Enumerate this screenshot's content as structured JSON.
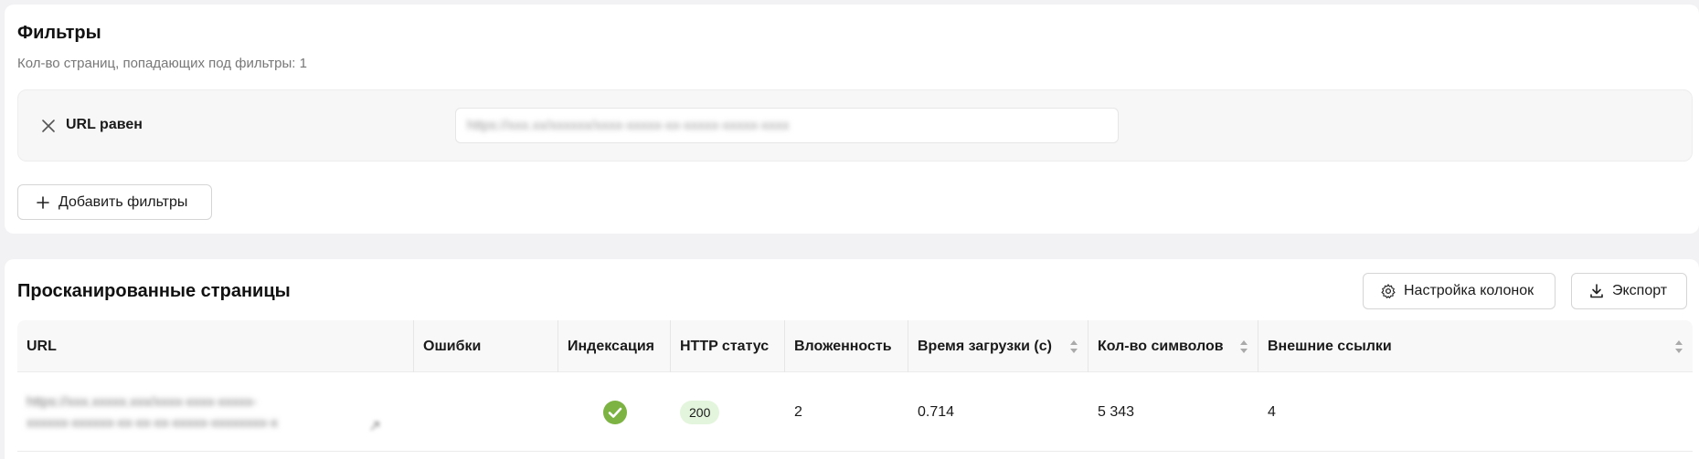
{
  "filters": {
    "title": "Фильтры",
    "count_text": "Кол-во страниц, попадающих под фильтры: 1",
    "condition": {
      "label": "URL равен",
      "value_blurred": "https://xxx.xx/xxxxxx/xxxx-xxxxx-xx-xxxxx-xxxxx-xxxx"
    },
    "add_button": "Добавить фильтры"
  },
  "pages": {
    "title": "Просканированные страницы",
    "columns_button": "Настройка колонок",
    "export_button": "Экспорт",
    "columns": [
      {
        "label": "URL",
        "sortable": false
      },
      {
        "label": "Ошибки",
        "sortable": false
      },
      {
        "label": "Индексация",
        "sortable": false
      },
      {
        "label": "HTTP статус",
        "sortable": false
      },
      {
        "label": "Вложенность",
        "sortable": false
      },
      {
        "label": "Время загрузки (с)",
        "sortable": true
      },
      {
        "label": "Кол-во символов",
        "sortable": true
      },
      {
        "label": "Внешние ссылки",
        "sortable": true
      }
    ],
    "rows": [
      {
        "url_line1": "https://xxx.xxxxx.xxx/xxxx-xxxx-xxxxx-",
        "url_line2": "xxxxxx-xxxxxx-xx-xx-xx-xxxxx-xxxxxxxx-x",
        "errors": "",
        "indexed": true,
        "http_status": "200",
        "depth": "2",
        "load_time": "0.714",
        "chars": "5 343",
        "external_links": "4"
      }
    ]
  },
  "colors": {
    "check_green": "#7cb342",
    "status_bg": "#e3f5dc",
    "page_bg": "#f2f2f4"
  }
}
